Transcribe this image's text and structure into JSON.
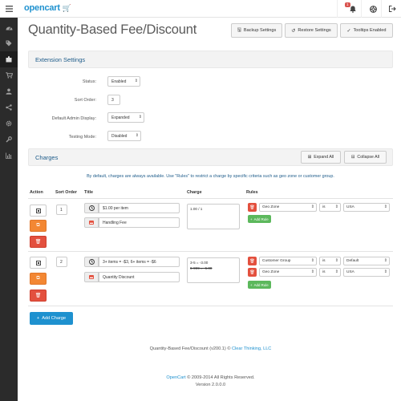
{
  "header": {
    "logo_text": "opencart",
    "notification_count": "1"
  },
  "page": {
    "title": "Quantity-Based Fee/Discount",
    "buttons": {
      "backup": "Backup Settings",
      "restore": "Restore Settings",
      "tooltips": "Tooltips Enabled"
    }
  },
  "extension_settings": {
    "heading": "Extension Settings",
    "fields": {
      "status": {
        "label": "Status:",
        "value": "Enabled"
      },
      "sort_order": {
        "label": "Sort Order:",
        "value": "3"
      },
      "admin_display": {
        "label": "Default Admin Display:",
        "value": "Expanded"
      },
      "testing_mode": {
        "label": "Testing Mode:",
        "value": "Disabled"
      }
    }
  },
  "charges": {
    "heading": "Charges",
    "expand_all": "Expand All",
    "collapse_all": "Collapse All",
    "note": "By default, charges are always available. Use \"Rules\" to restrict a charge by specific criteria such as geo zone or customer group.",
    "columns": {
      "action": "Action",
      "sort_order": "Sort Order",
      "title": "Title",
      "charge": "Charge",
      "rules": "Rules"
    },
    "add_rule_label": "Add Rule",
    "add_charge_label": "Add Charge",
    "rows": [
      {
        "sort_order": "1",
        "title": "$1.00 per item",
        "total_title": "Handling Fee",
        "charge_lines": [
          "1.00 / 1"
        ],
        "rules": [
          {
            "type": "Geo Zone",
            "operator": "is",
            "value": "USA"
          }
        ]
      },
      {
        "sort_order": "2",
        "title": "3+ items = -$3, 6+ items = -$6",
        "total_title": "Quantity Discount",
        "charge_lines": [
          "3-5 = -3.00",
          "6-999 = -6.00"
        ],
        "rules": [
          {
            "type": "Customer Group",
            "operator": "is",
            "value": "Default"
          },
          {
            "type": "Geo Zone",
            "operator": "is",
            "value": "USA"
          }
        ]
      }
    ]
  },
  "footer": {
    "credit_prefix": "Quantity-Based Fee/Discount (v200.1) © ",
    "credit_link": "Clear Thinking, LLC",
    "opencart_link": "OpenCart",
    "copyright": " © 2009-2014 All Rights Reserved.",
    "version": "Version 2.0.0.0"
  }
}
